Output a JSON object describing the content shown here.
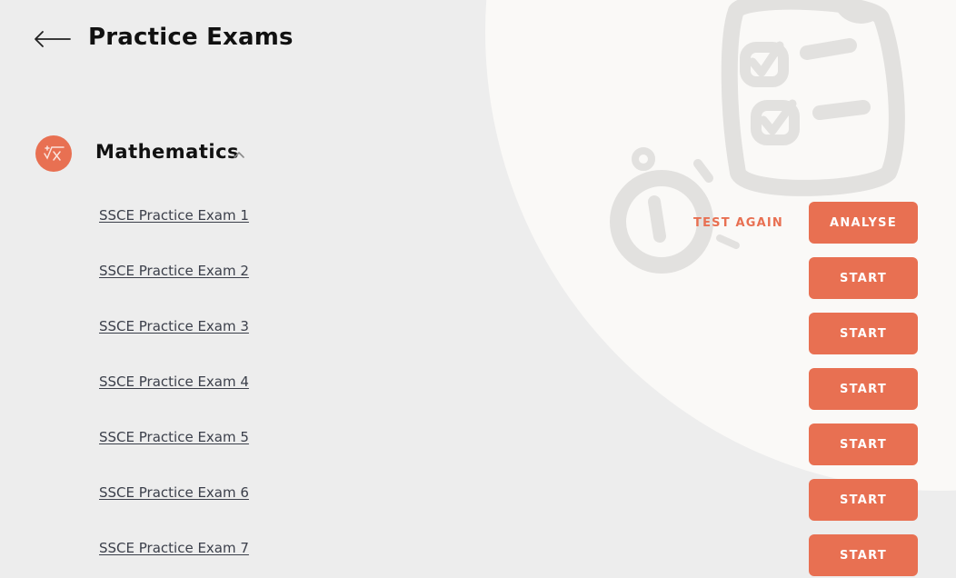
{
  "header": {
    "title": "Practice Exams",
    "back_icon": "arrow-left-icon"
  },
  "subject": {
    "name": "Mathematics",
    "icon": "math-symbols-icon",
    "caret_icon": "chevron-up-icon",
    "expanded": true
  },
  "exams": [
    {
      "title": "SSCE Practice Exam 1",
      "action": "ANALYSE",
      "secondary_action": "TEST AGAIN"
    },
    {
      "title": "SSCE Practice Exam 2",
      "action": "START"
    },
    {
      "title": "SSCE Practice Exam 3",
      "action": "START"
    },
    {
      "title": "SSCE Practice Exam 4",
      "action": "START"
    },
    {
      "title": "SSCE Practice Exam 5",
      "action": "START"
    },
    {
      "title": "SSCE Practice Exam 6",
      "action": "START"
    },
    {
      "title": "SSCE Practice Exam 7",
      "action": "START"
    }
  ],
  "colors": {
    "accent": "#e87052",
    "background": "#ededed",
    "blob": "#faf9f7",
    "illustration": "#e2e1df"
  },
  "decoration": {
    "illustration": "clipboard-checklist-stopwatch-illustration"
  }
}
